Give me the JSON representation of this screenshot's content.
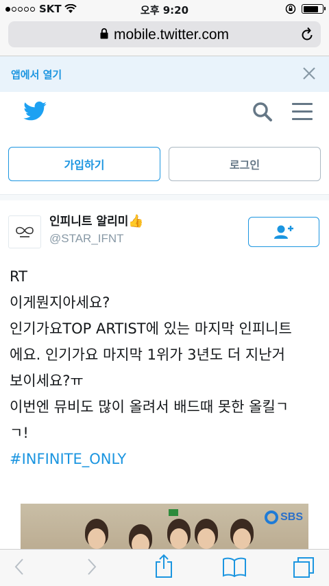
{
  "status_bar": {
    "carrier": "SKT",
    "time": "오후 9:20"
  },
  "browser": {
    "url": "mobile.twitter.com"
  },
  "app_banner": {
    "label": "앱에서 열기"
  },
  "auth": {
    "signup_label": "가입하기",
    "login_label": "로그인"
  },
  "tweet": {
    "display_name": "인피니트 알리미",
    "emoji": "👍",
    "handle": "@STAR_IFNT",
    "lines": [
      "RT",
      "이게뭔지아세요?",
      "인기가요TOP ARTIST에 있는 마지막 인피니트",
      "에요. 인기가요 마지막 1위가 3년도 더 지난거",
      "보이세요?ㅠ",
      "이번엔 뮤비도 많이 올려서 배드때 못한 올킬ㄱ",
      "ㄱ!"
    ],
    "hashtag": "#INFINITE_ONLY",
    "media_watermark": "SBS"
  },
  "colors": {
    "twitter_blue": "#1DA1F2",
    "link_blue": "#1b95e0",
    "gray_text": "#657786",
    "handle_gray": "#8899a6"
  },
  "icons": {
    "status": [
      "signal-dots-icon",
      "wifi-icon",
      "orientation-lock-icon",
      "battery-icon"
    ],
    "url": [
      "lock-icon",
      "reload-icon"
    ],
    "header": [
      "twitter-bird-icon",
      "search-icon",
      "menu-icon"
    ],
    "toolbar": [
      "back-icon",
      "forward-icon",
      "share-icon",
      "bookmarks-icon",
      "tabs-icon"
    ]
  }
}
